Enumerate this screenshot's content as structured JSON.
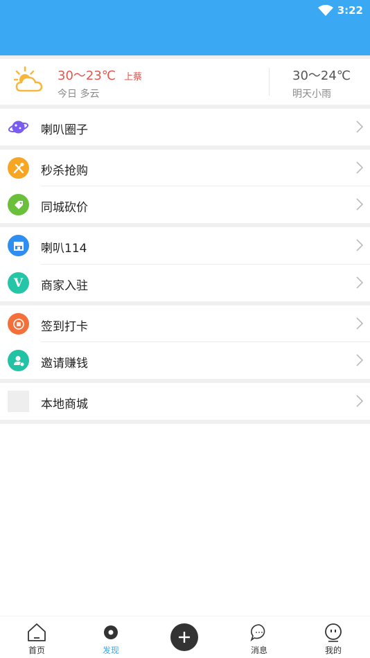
{
  "status_bar": {
    "time": "3:22",
    "wifi_icon": "wifi-icon"
  },
  "header": {
    "color": "#3aa8f2"
  },
  "weather": {
    "today_temp": "30～23℃",
    "city": "上蔡",
    "today_desc": "今日 多云",
    "tomorrow_temp": "30～24℃",
    "tomorrow_desc": "明天小雨",
    "icon": "sun-cloud-icon"
  },
  "menu": {
    "items": [
      {
        "label": "喇叭圈子",
        "icon": "planet-icon",
        "color": "#7a5cf0"
      },
      {
        "label": "秒杀抢购",
        "icon": "utensils-icon",
        "color": "#f6a623"
      },
      {
        "label": "同城砍价",
        "icon": "price-tag-icon",
        "color": "#6abf3b"
      },
      {
        "label": "喇叭114",
        "icon": "store-icon",
        "color": "#2f8ff0"
      },
      {
        "label": "商家入驻",
        "icon": "v-icon",
        "color": "#25c6a8",
        "glyph": "V"
      },
      {
        "label": "签到打卡",
        "icon": "checkin-icon",
        "color": "#f4703b"
      },
      {
        "label": "邀请赚钱",
        "icon": "invite-user-icon",
        "color": "#22c3a5"
      },
      {
        "label": "本地商城",
        "icon": "placeholder-image-icon",
        "color": "#eeeeee"
      }
    ]
  },
  "tabbar": {
    "active_color": "#3aa8f2",
    "tabs": [
      {
        "label": "首页",
        "icon": "home-icon"
      },
      {
        "label": "发现",
        "icon": "discover-icon",
        "active": true
      },
      {
        "label": "",
        "icon": "plus-icon"
      },
      {
        "label": "消息",
        "icon": "message-icon"
      },
      {
        "label": "我的",
        "icon": "profile-icon"
      }
    ]
  }
}
